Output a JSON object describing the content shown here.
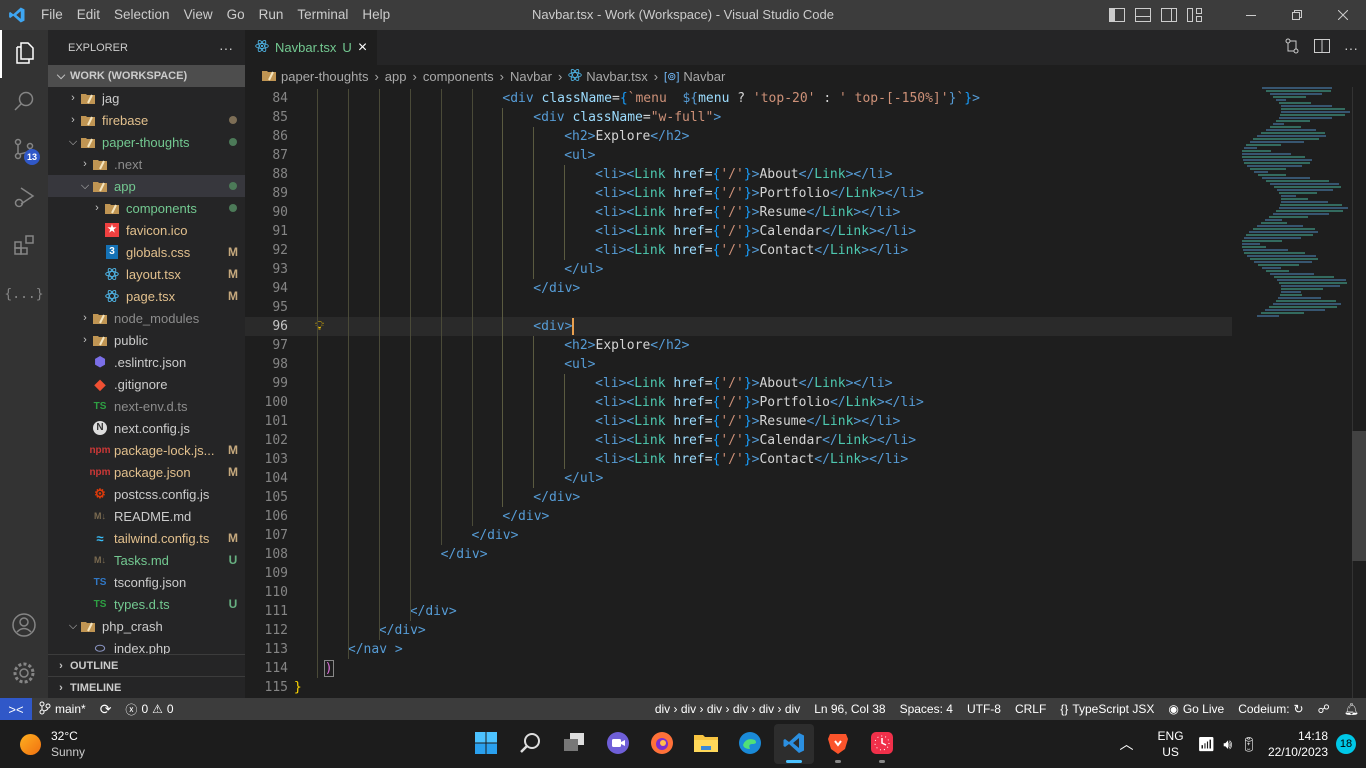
{
  "titlebar": {
    "menu": [
      "File",
      "Edit",
      "Selection",
      "View",
      "Go",
      "Run",
      "Terminal",
      "Help"
    ],
    "title": "Navbar.tsx - Work (Workspace) - Visual Studio Code"
  },
  "activitybar": {
    "items": [
      {
        "name": "explorer",
        "icon": "files-icon"
      },
      {
        "name": "search",
        "icon": "search-icon"
      },
      {
        "name": "source-control",
        "icon": "source-control-icon",
        "badge": "13"
      },
      {
        "name": "run-debug",
        "icon": "run-debug-icon"
      },
      {
        "name": "extensions",
        "icon": "extensions-icon"
      },
      {
        "name": "json",
        "icon": "braces-icon"
      }
    ],
    "bottom": [
      {
        "name": "accounts",
        "icon": "account-icon"
      },
      {
        "name": "manage",
        "icon": "gear-icon"
      }
    ]
  },
  "sidebar": {
    "title": "EXPLORER",
    "more": "···",
    "workspace": "WORK (WORKSPACE)",
    "tree": [
      {
        "name": "jag",
        "depth": 0,
        "type": "folder",
        "expanded": false,
        "color": "norm",
        "deco": ""
      },
      {
        "name": "firebase",
        "depth": 0,
        "type": "folder",
        "expanded": false,
        "color": "mod",
        "deco": "dot-mod"
      },
      {
        "name": "paper-thoughts",
        "depth": 0,
        "type": "folder",
        "expanded": true,
        "color": "green",
        "deco": "dot-green"
      },
      {
        "name": ".next",
        "depth": 1,
        "type": "folder",
        "expanded": false,
        "color": "dim",
        "deco": ""
      },
      {
        "name": "app",
        "depth": 1,
        "type": "folder",
        "expanded": true,
        "color": "green",
        "deco": "dot-green",
        "selected": true
      },
      {
        "name": "components",
        "depth": 2,
        "type": "folder",
        "expanded": false,
        "color": "green",
        "deco": "dot-green"
      },
      {
        "name": "favicon.ico",
        "depth": 2,
        "type": "file",
        "color": "mod",
        "deco": ""
      },
      {
        "name": "globals.css",
        "depth": 2,
        "type": "file",
        "color": "mod",
        "deco": "M"
      },
      {
        "name": "layout.tsx",
        "depth": 2,
        "type": "file",
        "color": "mod",
        "deco": "M"
      },
      {
        "name": "page.tsx",
        "depth": 2,
        "type": "file",
        "color": "mod",
        "deco": "M"
      },
      {
        "name": "node_modules",
        "depth": 1,
        "type": "folder",
        "expanded": false,
        "color": "dim",
        "deco": ""
      },
      {
        "name": "public",
        "depth": 1,
        "type": "folder",
        "expanded": false,
        "color": "norm",
        "deco": ""
      },
      {
        "name": ".eslintrc.json",
        "depth": 1,
        "type": "file",
        "color": "norm",
        "deco": ""
      },
      {
        "name": ".gitignore",
        "depth": 1,
        "type": "file",
        "color": "norm",
        "deco": ""
      },
      {
        "name": "next-env.d.ts",
        "depth": 1,
        "type": "file",
        "color": "dim",
        "deco": ""
      },
      {
        "name": "next.config.js",
        "depth": 1,
        "type": "file",
        "color": "norm",
        "deco": ""
      },
      {
        "name": "package-lock.js...",
        "depth": 1,
        "type": "file",
        "color": "mod",
        "deco": "M"
      },
      {
        "name": "package.json",
        "depth": 1,
        "type": "file",
        "color": "mod",
        "deco": "M"
      },
      {
        "name": "postcss.config.js",
        "depth": 1,
        "type": "file",
        "color": "norm",
        "deco": ""
      },
      {
        "name": "README.md",
        "depth": 1,
        "type": "file",
        "color": "norm",
        "deco": ""
      },
      {
        "name": "tailwind.config.ts",
        "depth": 1,
        "type": "file",
        "color": "mod",
        "deco": "M"
      },
      {
        "name": "Tasks.md",
        "depth": 1,
        "type": "file",
        "color": "green",
        "deco": "U"
      },
      {
        "name": "tsconfig.json",
        "depth": 1,
        "type": "file",
        "color": "norm",
        "deco": ""
      },
      {
        "name": "types.d.ts",
        "depth": 1,
        "type": "file",
        "color": "green",
        "deco": "U"
      },
      {
        "name": "php_crash",
        "depth": 0,
        "type": "folder",
        "expanded": true,
        "color": "norm",
        "deco": ""
      },
      {
        "name": "index.php",
        "depth": 1,
        "type": "file",
        "color": "norm",
        "deco": ""
      }
    ],
    "outline": "OUTLINE",
    "timeline": "TIMELINE"
  },
  "tab": {
    "label": "Navbar.tsx",
    "status": "U",
    "close": "×"
  },
  "breadcrumb": [
    "paper-thoughts",
    "app",
    "components",
    "Navbar",
    "Navbar.tsx",
    "Navbar"
  ],
  "editor": {
    "current_line": 96,
    "lines": [
      {
        "n": 84,
        "indent": 6,
        "html": "<span class='tg'>&lt;div</span> <span class='at'>className</span><span class='tx'>=</span><span class='br3'>{</span><span class='st'>`menu  </span><span class='tg'>${</span><span class='at'>menu</span> <span class='tx'>?</span> <span class='st'>'top-20'</span> <span class='tx'>:</span> <span class='st'>' top-[-150%]'</span><span class='tg'>}</span><span class='st'>`</span><span class='br3'>}</span><span class='tg'>&gt;</span>"
      },
      {
        "n": 85,
        "indent": 7,
        "html": "<span class='tg'>&lt;div</span> <span class='at'>className</span><span class='tx'>=</span><span class='st'>\"w-full\"</span><span class='tg'>&gt;</span>"
      },
      {
        "n": 86,
        "indent": 8,
        "html": "<span class='tg'>&lt;h2&gt;</span><span class='tx'>Explore</span><span class='tg'>&lt;/h2&gt;</span>"
      },
      {
        "n": 87,
        "indent": 8,
        "html": "<span class='tg'>&lt;ul&gt;</span>"
      },
      {
        "n": 88,
        "indent": 9,
        "html": "<span class='tg'>&lt;li&gt;&lt;</span><span class='lk'>Link</span> <span class='at'>href</span><span class='tx'>=</span><span class='br3'>{</span><span class='st'>'/'</span><span class='br3'>}</span><span class='tg'>&gt;</span><span class='tx'>About</span><span class='tg'>&lt;/</span><span class='lk'>Link</span><span class='tg'>&gt;&lt;/li&gt;</span>"
      },
      {
        "n": 89,
        "indent": 9,
        "html": "<span class='tg'>&lt;li&gt;&lt;</span><span class='lk'>Link</span> <span class='at'>href</span><span class='tx'>=</span><span class='br3'>{</span><span class='st'>'/'</span><span class='br3'>}</span><span class='tg'>&gt;</span><span class='tx'>Portfolio</span><span class='tg'>&lt;/</span><span class='lk'>Link</span><span class='tg'>&gt;&lt;/li&gt;</span>"
      },
      {
        "n": 90,
        "indent": 9,
        "html": "<span class='tg'>&lt;li&gt;&lt;</span><span class='lk'>Link</span> <span class='at'>href</span><span class='tx'>=</span><span class='br3'>{</span><span class='st'>'/'</span><span class='br3'>}</span><span class='tg'>&gt;</span><span class='tx'>Resume</span><span class='tg'>&lt;/</span><span class='lk'>Link</span><span class='tg'>&gt;&lt;/li&gt;</span>"
      },
      {
        "n": 91,
        "indent": 9,
        "html": "<span class='tg'>&lt;li&gt;&lt;</span><span class='lk'>Link</span> <span class='at'>href</span><span class='tx'>=</span><span class='br3'>{</span><span class='st'>'/'</span><span class='br3'>}</span><span class='tg'>&gt;</span><span class='tx'>Calendar</span><span class='tg'>&lt;/</span><span class='lk'>Link</span><span class='tg'>&gt;&lt;/li&gt;</span>"
      },
      {
        "n": 92,
        "indent": 9,
        "html": "<span class='tg'>&lt;li&gt;&lt;</span><span class='lk'>Link</span> <span class='at'>href</span><span class='tx'>=</span><span class='br3'>{</span><span class='st'>'/'</span><span class='br3'>}</span><span class='tg'>&gt;</span><span class='tx'>Contact</span><span class='tg'>&lt;/</span><span class='lk'>Link</span><span class='tg'>&gt;&lt;/li&gt;</span>"
      },
      {
        "n": 93,
        "indent": 8,
        "html": "<span class='tg'>&lt;/ul&gt;</span>"
      },
      {
        "n": 94,
        "indent": 7,
        "html": "<span class='tg'>&lt;/div&gt;</span>"
      },
      {
        "n": 95,
        "indent": 0,
        "html": ""
      },
      {
        "n": 96,
        "indent": 7,
        "html": "<span class='tg'>&lt;div&gt;</span><span class='cursor'></span>"
      },
      {
        "n": 97,
        "indent": 8,
        "html": "<span class='tg'>&lt;h2&gt;</span><span class='tx'>Explore</span><span class='tg'>&lt;/h2&gt;</span>"
      },
      {
        "n": 98,
        "indent": 8,
        "html": "<span class='tg'>&lt;ul&gt;</span>"
      },
      {
        "n": 99,
        "indent": 9,
        "html": "<span class='tg'>&lt;li&gt;&lt;</span><span class='lk'>Link</span> <span class='at'>href</span><span class='tx'>=</span><span class='br3'>{</span><span class='st'>'/'</span><span class='br3'>}</span><span class='tg'>&gt;</span><span class='tx'>About</span><span class='tg'>&lt;/</span><span class='lk'>Link</span><span class='tg'>&gt;&lt;/li&gt;</span>"
      },
      {
        "n": 100,
        "indent": 9,
        "html": "<span class='tg'>&lt;li&gt;&lt;</span><span class='lk'>Link</span> <span class='at'>href</span><span class='tx'>=</span><span class='br3'>{</span><span class='st'>'/'</span><span class='br3'>}</span><span class='tg'>&gt;</span><span class='tx'>Portfolio</span><span class='tg'>&lt;/</span><span class='lk'>Link</span><span class='tg'>&gt;&lt;/li&gt;</span>"
      },
      {
        "n": 101,
        "indent": 9,
        "html": "<span class='tg'>&lt;li&gt;&lt;</span><span class='lk'>Link</span> <span class='at'>href</span><span class='tx'>=</span><span class='br3'>{</span><span class='st'>'/'</span><span class='br3'>}</span><span class='tg'>&gt;</span><span class='tx'>Resume</span><span class='tg'>&lt;/</span><span class='lk'>Link</span><span class='tg'>&gt;&lt;/li&gt;</span>"
      },
      {
        "n": 102,
        "indent": 9,
        "html": "<span class='tg'>&lt;li&gt;&lt;</span><span class='lk'>Link</span> <span class='at'>href</span><span class='tx'>=</span><span class='br3'>{</span><span class='st'>'/'</span><span class='br3'>}</span><span class='tg'>&gt;</span><span class='tx'>Calendar</span><span class='tg'>&lt;/</span><span class='lk'>Link</span><span class='tg'>&gt;&lt;/li&gt;</span>"
      },
      {
        "n": 103,
        "indent": 9,
        "html": "<span class='tg'>&lt;li&gt;&lt;</span><span class='lk'>Link</span> <span class='at'>href</span><span class='tx'>=</span><span class='br3'>{</span><span class='st'>'/'</span><span class='br3'>}</span><span class='tg'>&gt;</span><span class='tx'>Contact</span><span class='tg'>&lt;/</span><span class='lk'>Link</span><span class='tg'>&gt;&lt;/li&gt;</span>"
      },
      {
        "n": 104,
        "indent": 8,
        "html": "<span class='tg'>&lt;/ul&gt;</span>"
      },
      {
        "n": 105,
        "indent": 7,
        "html": "<span class='tg'>&lt;/div&gt;</span>"
      },
      {
        "n": 106,
        "indent": 6,
        "html": "<span class='tg'>&lt;/div&gt;</span>"
      },
      {
        "n": 107,
        "indent": 5,
        "html": "<span class='tg'>&lt;/div&gt;</span>"
      },
      {
        "n": 108,
        "indent": 4,
        "html": "<span class='tg'>&lt;/div&gt;</span>"
      },
      {
        "n": 109,
        "indent": 0,
        "html": ""
      },
      {
        "n": 110,
        "indent": 0,
        "html": ""
      },
      {
        "n": 111,
        "indent": 3,
        "html": "<span class='tg'>&lt;/div&gt;</span>"
      },
      {
        "n": 112,
        "indent": 2,
        "html": "<span class='tg'>&lt;/div&gt;</span>"
      },
      {
        "n": 113,
        "indent": 1,
        "html": "<span class='tg'>&lt;/nav &gt;</span>"
      },
      {
        "n": 114,
        "indent": 0.25,
        "html": "<span class='br2' style='outline:1px solid #888'>)</span>"
      },
      {
        "n": 115,
        "indent": -0.75,
        "html": "<span class='br'>}</span>"
      }
    ]
  },
  "statusbar": {
    "branch": "main*",
    "errors": "0",
    "warnings": "0",
    "breadcrumb": "div › div › div › div › div › div",
    "position": "Ln 96, Col 38",
    "spaces": "Spaces: 4",
    "encoding": "UTF-8",
    "eol": "CRLF",
    "language": "TypeScript JSX",
    "golive": "Go Live",
    "codeium": "Codeium:"
  },
  "taskbar": {
    "weather_temp": "32°C",
    "weather_desc": "Sunny",
    "apps": [
      "start",
      "search",
      "task-view",
      "teams-chat",
      "firefox",
      "file-explorer",
      "edge",
      "vscode",
      "brave",
      "clock"
    ],
    "lang1": "ENG",
    "lang2": "US",
    "time": "14:18",
    "date": "22/10/2023",
    "notifications": "18"
  }
}
